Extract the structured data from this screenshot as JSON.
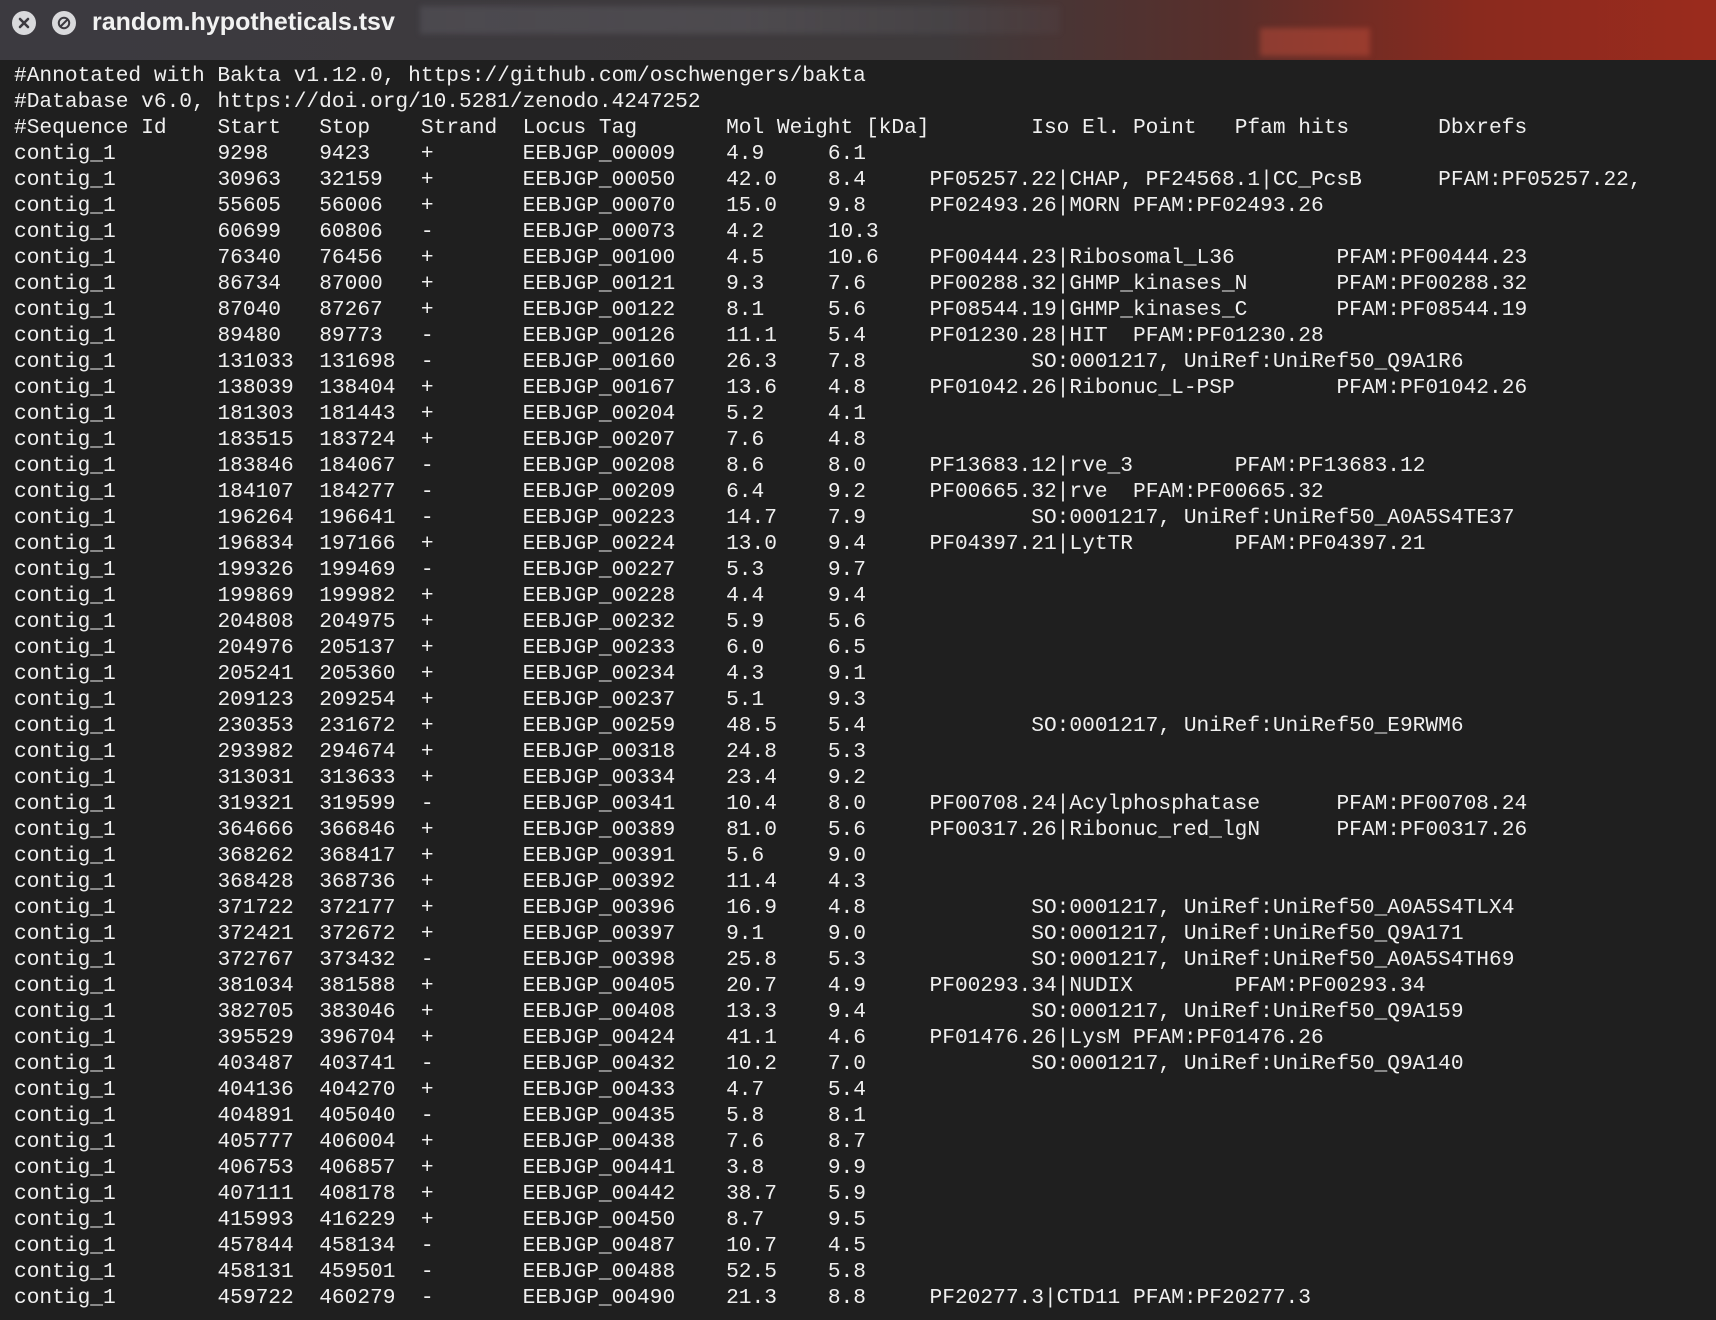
{
  "window": {
    "title": "random.hypotheticals.tsv"
  },
  "file": {
    "lines": [
      "#Annotated with Bakta v1.12.0, https://github.com/oschwengers/bakta",
      "#Database v6.0, https://doi.org/10.5281/zenodo.4247252",
      "#Sequence Id\tStart\tStop\tStrand\tLocus Tag\tMol Weight [kDa]\tIso El. Point\tPfam hits\tDbxrefs",
      "contig_1\t9298\t9423\t+\tEEBJGP_00009\t4.9\t6.1",
      "contig_1\t30963\t32159\t+\tEEBJGP_00050\t42.0\t8.4\tPF05257.22|CHAP, PF24568.1|CC_PcsB\tPFAM:PF05257.22,",
      "contig_1\t55605\t56006\t+\tEEBJGP_00070\t15.0\t9.8\tPF02493.26|MORN\tPFAM:PF02493.26",
      "contig_1\t60699\t60806\t-\tEEBJGP_00073\t4.2\t10.3",
      "contig_1\t76340\t76456\t+\tEEBJGP_00100\t4.5\t10.6\tPF00444.23|Ribosomal_L36\tPFAM:PF00444.23",
      "contig_1\t86734\t87000\t+\tEEBJGP_00121\t9.3\t7.6\tPF00288.32|GHMP_kinases_N\tPFAM:PF00288.32",
      "contig_1\t87040\t87267\t+\tEEBJGP_00122\t8.1\t5.6\tPF08544.19|GHMP_kinases_C\tPFAM:PF08544.19",
      "contig_1\t89480\t89773\t-\tEEBJGP_00126\t11.1\t5.4\tPF01230.28|HIT\tPFAM:PF01230.28",
      "contig_1\t131033\t131698\t-\tEEBJGP_00160\t26.3\t7.8\t\tSO:0001217, UniRef:UniRef50_Q9A1R6",
      "contig_1\t138039\t138404\t+\tEEBJGP_00167\t13.6\t4.8\tPF01042.26|Ribonuc_L-PSP\tPFAM:PF01042.26",
      "contig_1\t181303\t181443\t+\tEEBJGP_00204\t5.2\t4.1",
      "contig_1\t183515\t183724\t+\tEEBJGP_00207\t7.6\t4.8",
      "contig_1\t183846\t184067\t-\tEEBJGP_00208\t8.6\t8.0\tPF13683.12|rve_3\tPFAM:PF13683.12",
      "contig_1\t184107\t184277\t-\tEEBJGP_00209\t6.4\t9.2\tPF00665.32|rve\tPFAM:PF00665.32",
      "contig_1\t196264\t196641\t-\tEEBJGP_00223\t14.7\t7.9\t\tSO:0001217, UniRef:UniRef50_A0A5S4TE37",
      "contig_1\t196834\t197166\t+\tEEBJGP_00224\t13.0\t9.4\tPF04397.21|LytTR\tPFAM:PF04397.21",
      "contig_1\t199326\t199469\t-\tEEBJGP_00227\t5.3\t9.7",
      "contig_1\t199869\t199982\t+\tEEBJGP_00228\t4.4\t9.4",
      "contig_1\t204808\t204975\t+\tEEBJGP_00232\t5.9\t5.6",
      "contig_1\t204976\t205137\t+\tEEBJGP_00233\t6.0\t6.5",
      "contig_1\t205241\t205360\t+\tEEBJGP_00234\t4.3\t9.1",
      "contig_1\t209123\t209254\t+\tEEBJGP_00237\t5.1\t9.3",
      "contig_1\t230353\t231672\t+\tEEBJGP_00259\t48.5\t5.4\t\tSO:0001217, UniRef:UniRef50_E9RWM6",
      "contig_1\t293982\t294674\t+\tEEBJGP_00318\t24.8\t5.3",
      "contig_1\t313031\t313633\t+\tEEBJGP_00334\t23.4\t9.2",
      "contig_1\t319321\t319599\t-\tEEBJGP_00341\t10.4\t8.0\tPF00708.24|Acylphosphatase\tPFAM:PF00708.24",
      "contig_1\t364666\t366846\t+\tEEBJGP_00389\t81.0\t5.6\tPF00317.26|Ribonuc_red_lgN\tPFAM:PF00317.26",
      "contig_1\t368262\t368417\t+\tEEBJGP_00391\t5.6\t9.0",
      "contig_1\t368428\t368736\t+\tEEBJGP_00392\t11.4\t4.3",
      "contig_1\t371722\t372177\t+\tEEBJGP_00396\t16.9\t4.8\t\tSO:0001217, UniRef:UniRef50_A0A5S4TLX4",
      "contig_1\t372421\t372672\t+\tEEBJGP_00397\t9.1\t9.0\t\tSO:0001217, UniRef:UniRef50_Q9A171",
      "contig_1\t372767\t373432\t-\tEEBJGP_00398\t25.8\t5.3\t\tSO:0001217, UniRef:UniRef50_A0A5S4TH69",
      "contig_1\t381034\t381588\t+\tEEBJGP_00405\t20.7\t4.9\tPF00293.34|NUDIX\tPFAM:PF00293.34",
      "contig_1\t382705\t383046\t+\tEEBJGP_00408\t13.3\t9.4\t\tSO:0001217, UniRef:UniRef50_Q9A159",
      "contig_1\t395529\t396704\t+\tEEBJGP_00424\t41.1\t4.6\tPF01476.26|LysM\tPFAM:PF01476.26",
      "contig_1\t403487\t403741\t-\tEEBJGP_00432\t10.2\t7.0\t\tSO:0001217, UniRef:UniRef50_Q9A140",
      "contig_1\t404136\t404270\t+\tEEBJGP_00433\t4.7\t5.4",
      "contig_1\t404891\t405040\t-\tEEBJGP_00435\t5.8\t8.1",
      "contig_1\t405777\t406004\t+\tEEBJGP_00438\t7.6\t8.7",
      "contig_1\t406753\t406857\t+\tEEBJGP_00441\t3.8\t9.9",
      "contig_1\t407111\t408178\t+\tEEBJGP_00442\t38.7\t5.9",
      "contig_1\t415993\t416229\t+\tEEBJGP_00450\t8.7\t9.5",
      "contig_1\t457844\t458134\t-\tEEBJGP_00487\t10.7\t4.5",
      "contig_1\t458131\t459501\t-\tEEBJGP_00488\t52.5\t5.8",
      "contig_1\t459722\t460279\t-\tEEBJGP_00490\t21.3\t8.8\tPF20277.3|CTD11\tPFAM:PF20277.3"
    ]
  }
}
